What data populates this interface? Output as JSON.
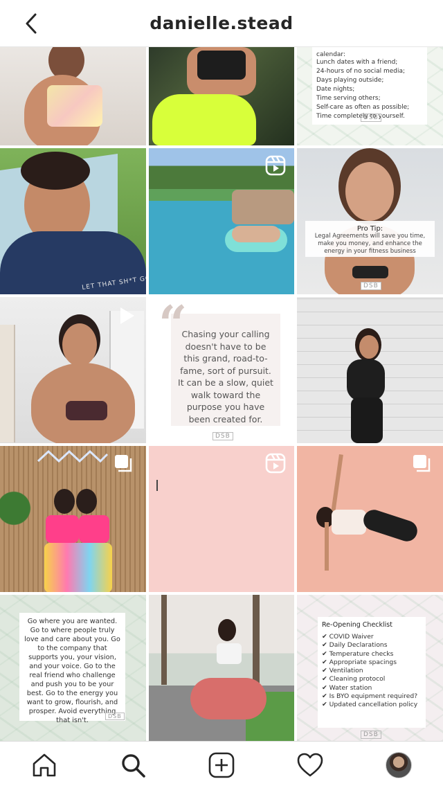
{
  "header": {
    "title": "danielle.stead"
  },
  "posts": {
    "p3": {
      "heading": "calendar:",
      "items": [
        "Lunch dates with a friend;",
        "24-hours of no social media;",
        "Days playing outside;",
        "Date nights;",
        "Time serving others;",
        "Self-care as often as possible;",
        "Time completely to yourself."
      ],
      "logo": "DSB"
    },
    "p4": {
      "shirt_text": "LET THAT SH*T GO"
    },
    "p6": {
      "title": "Pro Tip:",
      "body": "Legal Agreements will save you time, make you money, and enhance the energy in your fitness business",
      "logo": "DSB"
    },
    "p8": {
      "quote": "Chasing your calling doesn't have to be this grand, road-to-fame, sort of pursuit. It can be a slow, quiet walk toward the purpose you have been created for.",
      "logo": "DSB"
    },
    "p13": {
      "quote": "Go where you are wanted. Go to where people truly love and care about you. Go to the company that supports you, your vision, and your voice. Go to the real friend who challenge and push you to be your best. Go to the energy you want to grow, flourish, and prosper. Avoid everything that isn't.",
      "logo": "DSB"
    },
    "p15": {
      "title": "Re-Opening Checklist",
      "items": [
        "COVID Waiver",
        "Daily Declarations",
        "Temperature checks",
        "Appropriate spacings",
        "Ventilation",
        "Cleaning protocol",
        "Water station",
        "Is BYO equipment required?",
        "Updated cancellation policy"
      ],
      "logo": "DSB"
    }
  },
  "colors": {
    "pink": "#f8d0cc",
    "salmon": "#f1b5a3",
    "text": "#262626"
  },
  "tabs": [
    "home-icon",
    "search-icon",
    "new-post-icon",
    "activity-icon",
    "profile-icon"
  ]
}
